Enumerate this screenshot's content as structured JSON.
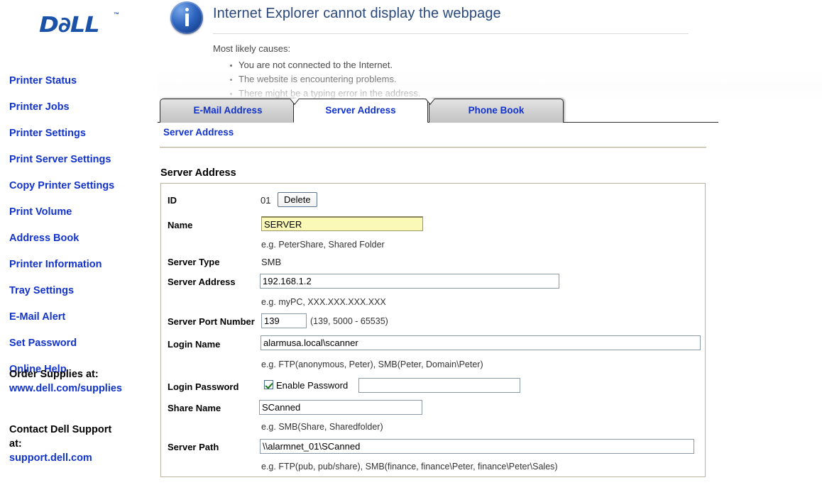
{
  "browser_error": {
    "icon": "info-icon",
    "title": "Internet Explorer cannot display the webpage",
    "causes_label": "Most likely causes:",
    "causes": [
      "You are not connected to the Internet.",
      "The website is encountering problems.",
      "There might be a typing error in the address."
    ]
  },
  "sidebar": {
    "logo": "D∂LL",
    "logo_tm": "™",
    "items": [
      {
        "label": "Printer Status"
      },
      {
        "label": "Printer Jobs"
      },
      {
        "label": "Printer Settings"
      },
      {
        "label": "Print Server Settings"
      },
      {
        "label": "Copy Printer Settings"
      },
      {
        "label": "Print Volume"
      },
      {
        "label": "Address Book"
      },
      {
        "label": "Printer Information"
      },
      {
        "label": "Tray Settings"
      },
      {
        "label": "E-Mail Alert"
      },
      {
        "label": "Set Password"
      },
      {
        "label": "Online Help"
      }
    ],
    "order_supplies": {
      "text": "Order Supplies at:",
      "link": "www.dell.com/supplies"
    },
    "contact_support": {
      "text_line1": "Contact Dell Support",
      "text_line2": "at:",
      "link": "support.dell.com"
    }
  },
  "tabs": [
    {
      "label": "E-Mail Address",
      "active": false
    },
    {
      "label": "Server Address",
      "active": true
    },
    {
      "label": "Phone Book",
      "active": false
    }
  ],
  "breadcrumb": "Server Address",
  "section_title": "Server Address",
  "form": {
    "id": {
      "label": "ID",
      "value": "01",
      "delete_button": "Delete"
    },
    "name": {
      "label": "Name",
      "value": "SERVER",
      "hint": "e.g. PeterShare, Shared Folder"
    },
    "server_type": {
      "label": "Server Type",
      "value": "SMB"
    },
    "server_address": {
      "label": "Server Address",
      "value": "192.168.1.2",
      "hint": "e.g. myPC, XXX.XXX.XXX.XXX"
    },
    "server_port": {
      "label": "Server Port Number",
      "value": "139",
      "hint": "(139, 5000 - 65535)"
    },
    "login_name": {
      "label": "Login Name",
      "value": "alarmusa.local\\scanner",
      "hint": "e.g. FTP(anonymous, Peter), SMB(Peter, Domain\\Peter)"
    },
    "login_password": {
      "label": "Login Password",
      "checkbox_label": "Enable Password",
      "checked": true,
      "value": ""
    },
    "share_name": {
      "label": "Share Name",
      "value": "SCanned",
      "hint": "e.g. SMB(Share, Sharedfolder)"
    },
    "server_path": {
      "label": "Server Path",
      "value": "\\\\alarmnet_01\\SCanned",
      "hint": "e.g. FTP(pub, pub/share), SMB(finance, finance\\Peter, finance\\Peter\\Sales)"
    }
  },
  "colors": {
    "link": "#1133CC",
    "autofill": "#FAF9B8",
    "rule": "#B9B5A0",
    "ie_title": "#29487D"
  }
}
